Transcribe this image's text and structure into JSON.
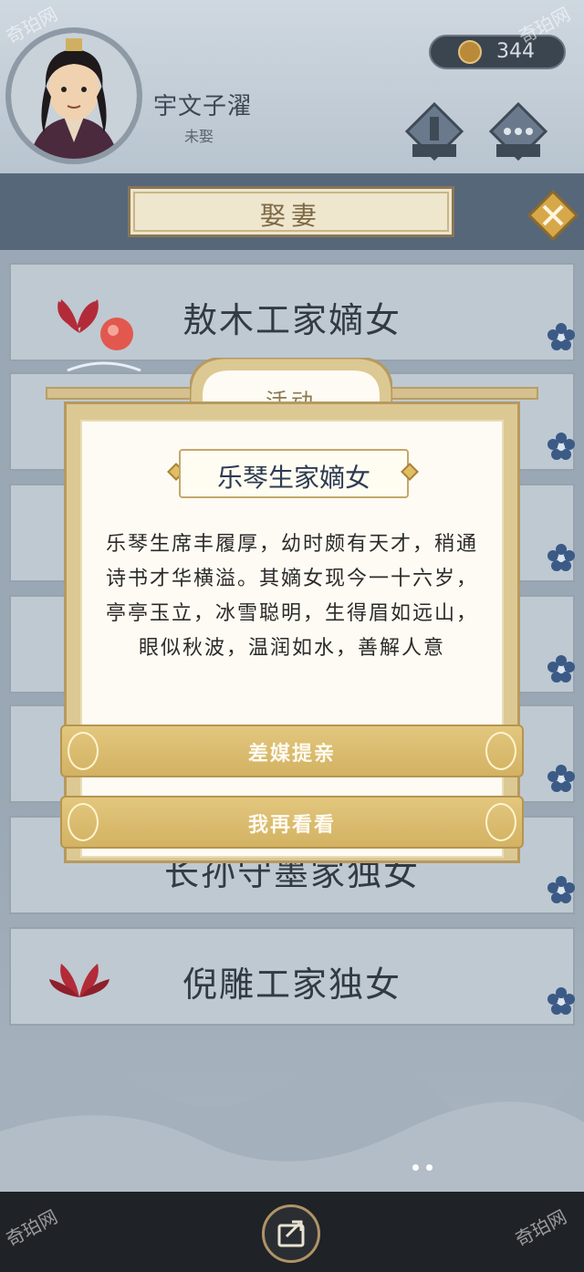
{
  "header": {
    "player_name": "宇文子濯",
    "player_title": "未娶",
    "coins": "344"
  },
  "title_bar": {
    "title": "娶妻"
  },
  "list": [
    {
      "label": "敖木工家嫡女"
    },
    {
      "label": ""
    },
    {
      "label": ""
    },
    {
      "label": ""
    },
    {
      "label": ""
    },
    {
      "label": "长孙守墨家独女"
    },
    {
      "label": "倪雕工家独女"
    }
  ],
  "modal": {
    "header": "活动",
    "name": "乐琴生家嫡女",
    "description": "乐琴生席丰履厚，幼时颇有天才，稍通诗书才华横溢。其嫡女现今一十六岁，亭亭玉立，冰雪聪明，生得眉如远山，眼似秋波，温润如水，善解人意",
    "primary_button": "差媒提亲",
    "secondary_button": "我再看看"
  },
  "watermark": "奇珀网",
  "colors": {
    "accent_gold": "#d3b262",
    "dark_bar": "#1f2226"
  }
}
